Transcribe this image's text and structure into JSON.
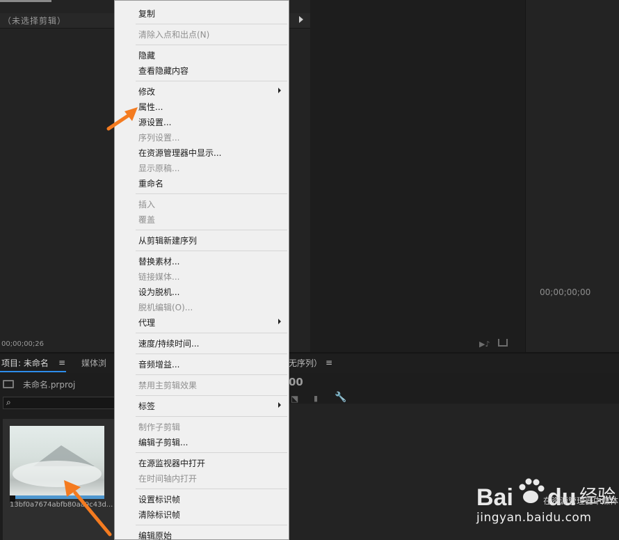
{
  "source_monitor": {
    "title": "（未选择剪辑）",
    "timecode": "00;00;00;26"
  },
  "program_monitor": {
    "timecode": "00;00;00;00"
  },
  "project_panel": {
    "active_tab": "项目: 未命名",
    "media_tab": "媒体浏",
    "menu_glyph": "≡",
    "file_name": "未命名.prproj",
    "clip_name": "13bf0a7674abfb80aa9c43d...",
    "search_glyph": "⌕"
  },
  "sequence_panel": {
    "tab": "无序列）",
    "menu_glyph": "≡",
    "timecode_fragment": "00",
    "wrench_glyph": "🔧"
  },
  "context_menu": {
    "items": [
      {
        "label": "复制",
        "enabled": true
      },
      {
        "label": "清除入点和出点(N)",
        "enabled": false
      },
      {
        "label": "隐藏",
        "enabled": true
      },
      {
        "label": "查看隐藏内容",
        "enabled": true
      },
      {
        "label": "修改",
        "enabled": true,
        "submenu": true
      },
      {
        "label": "属性...",
        "enabled": true
      },
      {
        "label": "源设置...",
        "enabled": true
      },
      {
        "label": "序列设置...",
        "enabled": false
      },
      {
        "label": "在资源管理器中显示...",
        "enabled": true
      },
      {
        "label": "显示原稿...",
        "enabled": false
      },
      {
        "label": "重命名",
        "enabled": true
      },
      {
        "label": "插入",
        "enabled": false
      },
      {
        "label": "覆盖",
        "enabled": false
      },
      {
        "label": "从剪辑新建序列",
        "enabled": true
      },
      {
        "label": "替换素材...",
        "enabled": true
      },
      {
        "label": "链接媒体...",
        "enabled": false
      },
      {
        "label": "设为脱机...",
        "enabled": true
      },
      {
        "label": "脱机编辑(O)...",
        "enabled": false
      },
      {
        "label": "代理",
        "enabled": true,
        "submenu": true
      },
      {
        "label": "速度/持续时间...",
        "enabled": true
      },
      {
        "label": "音频增益...",
        "enabled": true
      },
      {
        "label": "禁用主剪辑效果",
        "enabled": false
      },
      {
        "label": "标签",
        "enabled": true,
        "submenu": true
      },
      {
        "label": "制作子剪辑",
        "enabled": false
      },
      {
        "label": "编辑子剪辑...",
        "enabled": true
      },
      {
        "label": "在源监视器中打开",
        "enabled": true
      },
      {
        "label": "在时间轴内打开",
        "enabled": false
      },
      {
        "label": "设置标识帧",
        "enabled": true
      },
      {
        "label": "清除标识帧",
        "enabled": true
      },
      {
        "label": "编辑原始",
        "enabled": true
      }
    ]
  },
  "watermark": {
    "brand": "Bai du 经验",
    "url": "jingyan.baidu.com",
    "overlay_text": "在资源管理器中媒体以创"
  },
  "colors": {
    "annotation_arrow": "#f47b20",
    "accent_tab": "#2d8ceb"
  }
}
